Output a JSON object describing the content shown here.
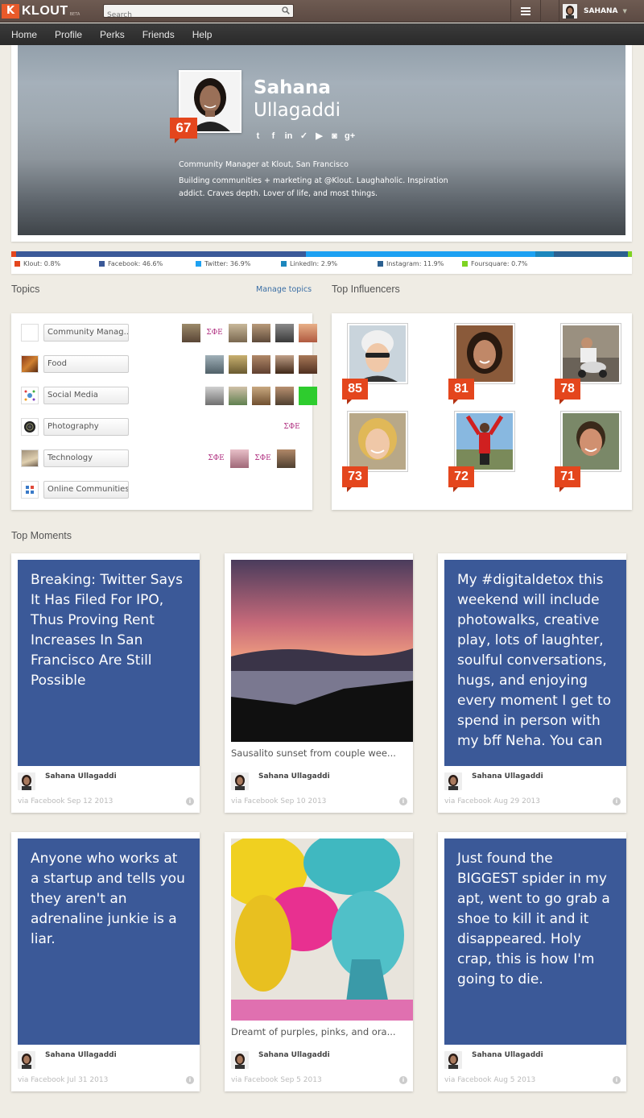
{
  "topbar": {
    "logo_mark": "K",
    "logo_text": "KLOUT",
    "logo_badge": "BETA",
    "search_placeholder": "Search",
    "user_name": "SAHANA",
    "caret": "▼"
  },
  "nav": [
    "Home",
    "Profile",
    "Perks",
    "Friends",
    "Help"
  ],
  "profile": {
    "score": "67",
    "first_name": "Sahana",
    "last_name": "Ullagaddi",
    "social_icons": [
      "twitter-icon",
      "facebook-icon",
      "linkedin-icon",
      "foursquare-icon",
      "youtube-icon",
      "instagram-icon",
      "googleplus-icon"
    ],
    "social_glyphs": [
      "t",
      "f",
      "in",
      "✓",
      "▶",
      "◙",
      "g+"
    ],
    "title": "Community Manager at Klout, San Francisco",
    "bio": "Building communities + marketing at @Klout. Laughaholic. Inspiration addict. Craves depth. Lover of life, and most things."
  },
  "networks": [
    {
      "label": "Klout: 0.8%",
      "share": 0.8,
      "color": "#e4461d"
    },
    {
      "label": "Facebook: 46.6%",
      "share": 46.6,
      "color": "#3b5998"
    },
    {
      "label": "Twitter: 36.9%",
      "share": 36.9,
      "color": "#1da1f2"
    },
    {
      "label": "LinkedIn: 2.9%",
      "share": 2.9,
      "color": "#1c87bd"
    },
    {
      "label": "Instagram: 11.9%",
      "share": 11.9,
      "color": "#2c6090"
    },
    {
      "label": "Foursquare: 0.7%",
      "share": 0.7,
      "color": "#7ed321"
    }
  ],
  "topics": {
    "title": "Topics",
    "manage_link": "Manage topics",
    "items": [
      {
        "label": "Community Manag..."
      },
      {
        "label": "Food"
      },
      {
        "label": "Social Media"
      },
      {
        "label": "Photography"
      },
      {
        "label": "Technology"
      },
      {
        "label": "Online Communities"
      }
    ],
    "greek_letters": "ΣΦΕ"
  },
  "influencers": {
    "title": "Top Influencers",
    "items": [
      {
        "score": "85"
      },
      {
        "score": "81"
      },
      {
        "score": "78"
      },
      {
        "score": "73"
      },
      {
        "score": "72"
      },
      {
        "score": "71"
      }
    ]
  },
  "moments": {
    "title": "Top Moments",
    "items": [
      {
        "type": "text",
        "text": "Breaking: Twitter Says It Has Filed For IPO, Thus Proving Rent Increases In San Francisco Are Still Possible",
        "author": "Sahana Ullagaddi",
        "via": "via Facebook Sep 12 2013"
      },
      {
        "type": "photo",
        "caption": "Sausalito sunset from couple wee...",
        "author": "Sahana Ullagaddi",
        "via": "via Facebook Sep 10 2013"
      },
      {
        "type": "text",
        "text": "My #digitaldetox this weekend will include photowalks, creative play, lots of laughter, soulful conversations, hugs, and enjoying every moment I get to spend in person with my bff Neha. You can",
        "author": "Sahana Ullagaddi",
        "via": "via Facebook Aug 29 2013"
      },
      {
        "type": "text",
        "text": "Anyone who works at a startup and tells you they aren't an adrenaline junkie is a liar.",
        "author": "Sahana Ullagaddi",
        "via": "via Facebook Jul 31 2013"
      },
      {
        "type": "photo",
        "caption": "Dreamt of purples, pinks, and ora...",
        "author": "Sahana Ullagaddi",
        "via": "via Facebook Sep 5 2013"
      },
      {
        "type": "text",
        "text": "Just found the BIGGEST spider in my apt, went to go grab a shoe to kill it and it disappeared. Holy crap, this is how I'm going to die.",
        "author": "Sahana Ullagaddi",
        "via": "via Facebook Aug 5 2013"
      }
    ],
    "info_glyph": "i"
  }
}
